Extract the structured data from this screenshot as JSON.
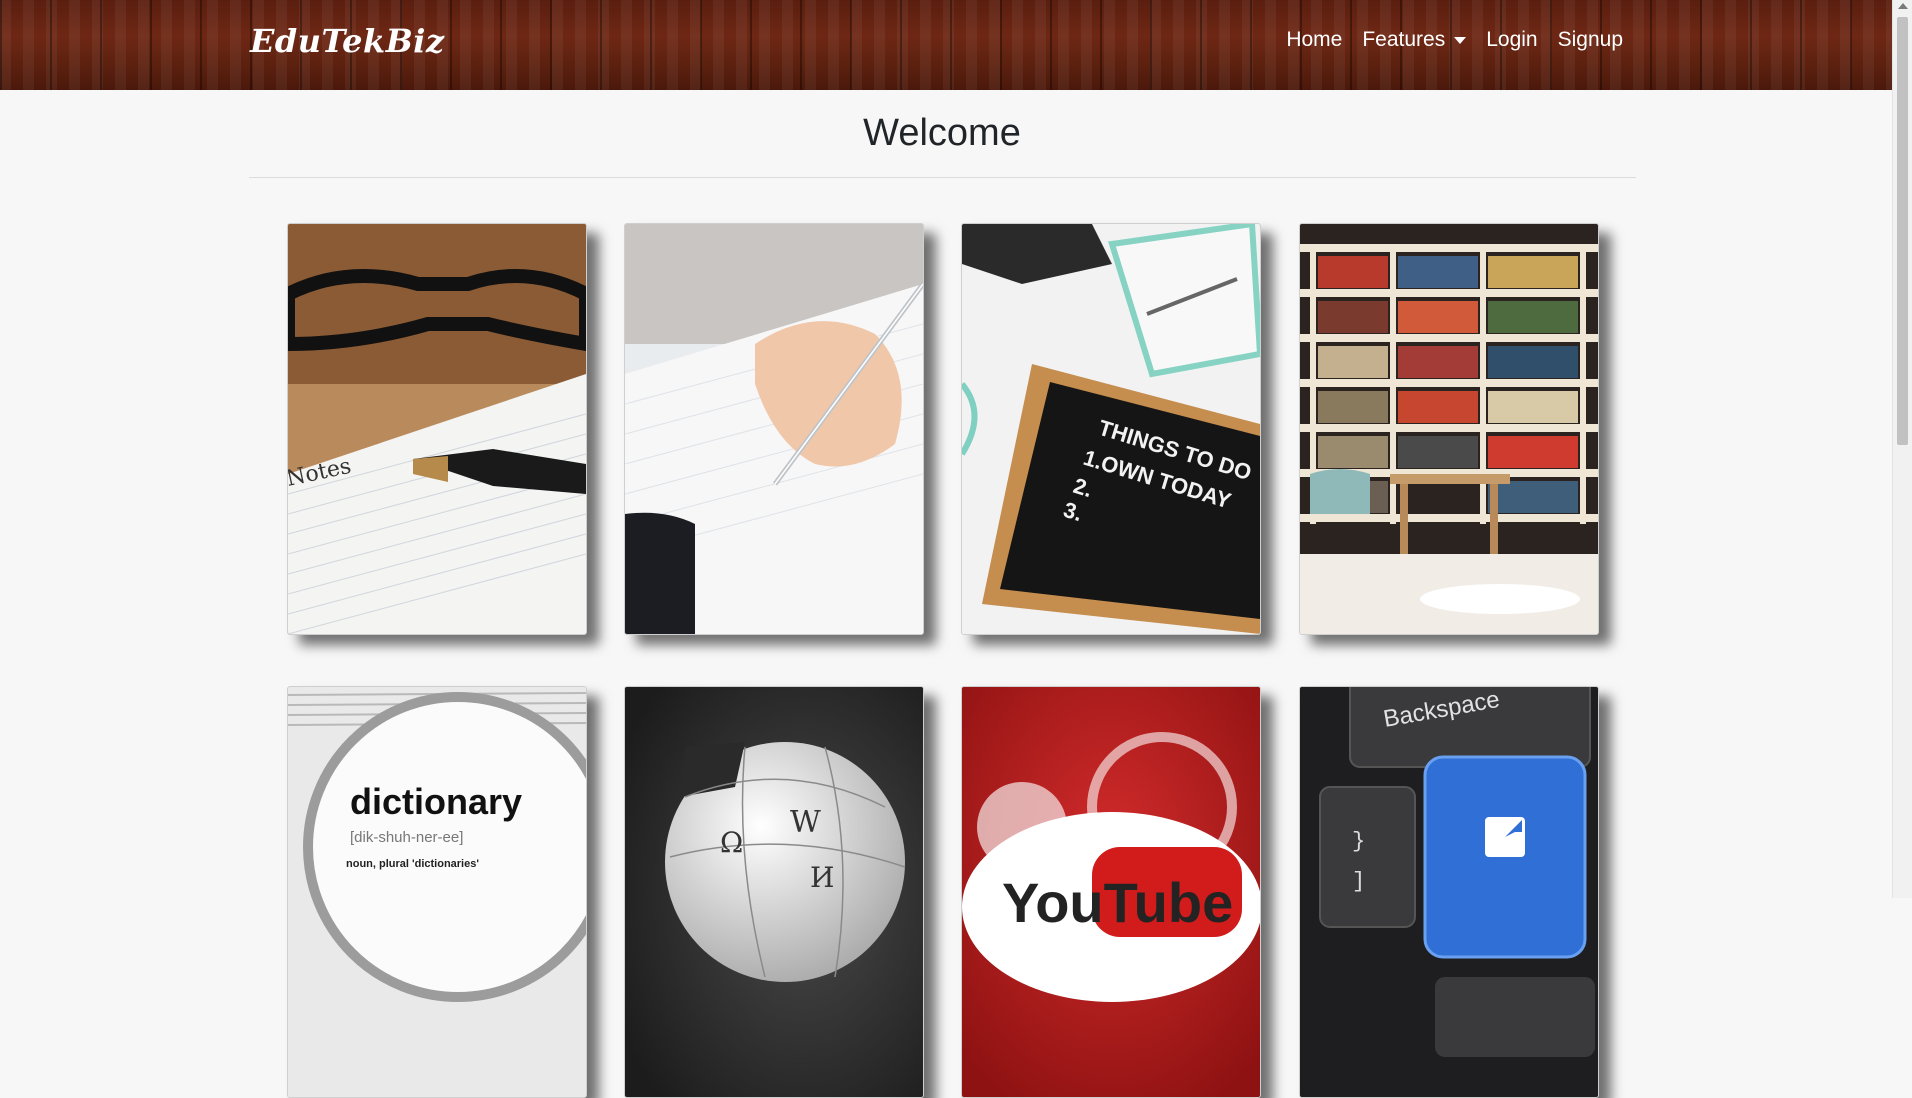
{
  "brand": "EduTekBiz",
  "nav": {
    "home": "Home",
    "features": "Features",
    "login": "Login",
    "signup": "Signup"
  },
  "page_title": "Welcome",
  "cards": {
    "notes_text": "Notes",
    "todo_line1": "THINGS TO DO",
    "todo_line2": "1.OWN TODAY",
    "todo_line3": "2.",
    "todo_line4": "3.",
    "dictionary_word": "dictionary",
    "dictionary_pron": "[dik-shuh-ner-ee]",
    "dictionary_def": "noun, plural 'dictionaries'",
    "wiki_glyph1": "W",
    "wiki_glyph2": "Ω",
    "wiki_glyph3": "И",
    "youtube_text": "YouTube",
    "backspace_label": "Backspace"
  }
}
